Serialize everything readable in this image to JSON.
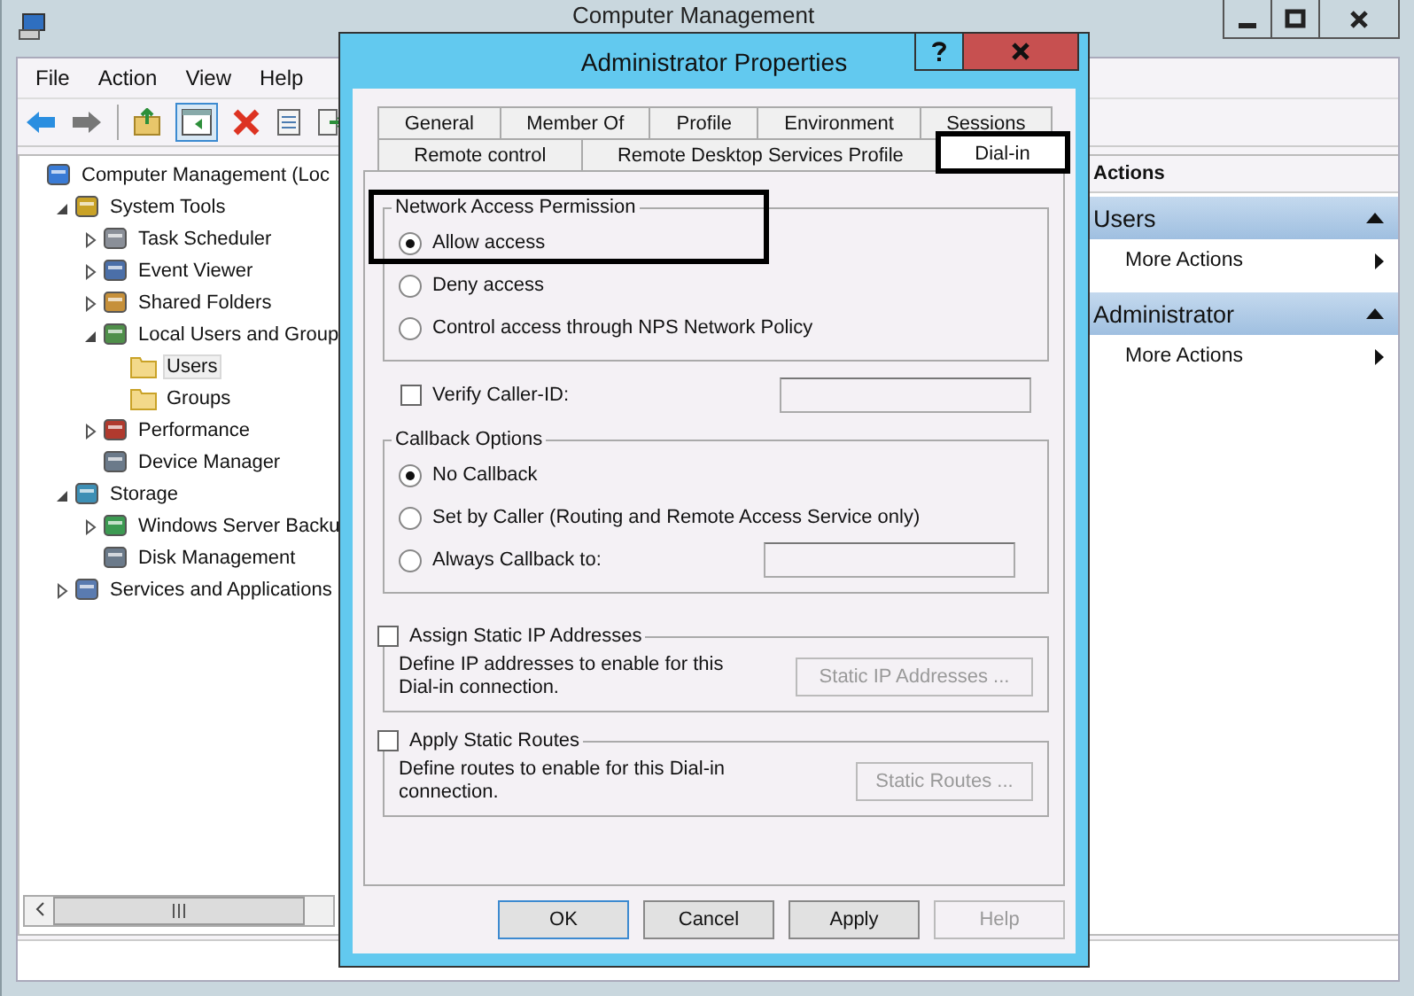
{
  "main_window": {
    "title": "Computer Management",
    "menu": [
      "File",
      "Action",
      "View",
      "Help"
    ],
    "tree": [
      {
        "label": "Computer Management (Loc",
        "selected": false,
        "children": [
          {
            "label": "System Tools",
            "expanded": true,
            "selected": false,
            "children": [
              {
                "label": "Task Scheduler",
                "expanded": false,
                "selected": false
              },
              {
                "label": "Event Viewer",
                "expanded": false,
                "selected": false
              },
              {
                "label": "Shared Folders",
                "expanded": false,
                "selected": false
              },
              {
                "label": "Local Users and Group",
                "expanded": true,
                "selected": false,
                "children": [
                  {
                    "label": "Users",
                    "selected": true
                  },
                  {
                    "label": "Groups",
                    "selected": false
                  }
                ]
              },
              {
                "label": "Performance",
                "expanded": false,
                "selected": false
              },
              {
                "label": "Device Manager",
                "selected": false
              }
            ]
          },
          {
            "label": "Storage",
            "expanded": true,
            "selected": false,
            "children": [
              {
                "label": "Windows Server Backu",
                "expanded": false,
                "selected": false
              },
              {
                "label": "Disk Management",
                "selected": false
              }
            ]
          },
          {
            "label": "Services and Applications",
            "expanded": false,
            "selected": false
          }
        ]
      }
    ],
    "actions": {
      "title": "Actions",
      "sections": [
        {
          "title": "Users",
          "expanded": true,
          "items": [
            "More Actions"
          ]
        },
        {
          "title": "Administrator",
          "expanded": true,
          "items": [
            "More Actions"
          ]
        }
      ]
    }
  },
  "dialog": {
    "title": "Administrator Properties",
    "tab_rows": [
      [
        {
          "label": "General",
          "selected": false,
          "highlighted": false
        },
        {
          "label": "Member Of",
          "selected": false,
          "highlighted": false
        },
        {
          "label": "Profile",
          "selected": false,
          "highlighted": false
        },
        {
          "label": "Environment",
          "selected": false,
          "highlighted": false
        },
        {
          "label": "Sessions",
          "selected": false,
          "highlighted": false
        }
      ],
      [
        {
          "label": "Remote control",
          "selected": false,
          "highlighted": false
        },
        {
          "label": "Remote Desktop Services Profile",
          "selected": false,
          "highlighted": false
        },
        {
          "label": "Dial-in",
          "selected": true,
          "highlighted": true
        }
      ]
    ],
    "network_access": {
      "title": "Network Access Permission",
      "highlighted": true,
      "options": [
        {
          "label": "Allow access",
          "selected": true
        },
        {
          "label": "Deny access",
          "selected": false
        },
        {
          "label": "Control access through NPS Network Policy",
          "selected": false
        }
      ]
    },
    "verify_caller_id": {
      "label": "Verify Caller-ID:",
      "checked": false
    },
    "callback": {
      "title": "Callback Options",
      "options": [
        {
          "label": "No Callback",
          "selected": true
        },
        {
          "label": "Set by Caller (Routing and Remote Access Service only)",
          "selected": false
        },
        {
          "label": "Always Callback to:",
          "selected": false
        }
      ]
    },
    "static_groups": [
      {
        "label": "Assign Static IP Addresses",
        "checked": false,
        "description": "Define IP addresses to enable for this Dial-in connection.",
        "button": "Static IP Addresses ..."
      },
      {
        "label": "Apply Static Routes",
        "checked": false,
        "description": "Define routes to enable for this Dial-in connection.",
        "button": "Static Routes ..."
      }
    ],
    "buttons": [
      {
        "label": "OK",
        "disabled": false,
        "default": true
      },
      {
        "label": "Cancel",
        "disabled": false,
        "default": false
      },
      {
        "label": "Apply",
        "disabled": false,
        "default": false
      },
      {
        "label": "Help",
        "disabled": true,
        "default": false
      }
    ]
  }
}
